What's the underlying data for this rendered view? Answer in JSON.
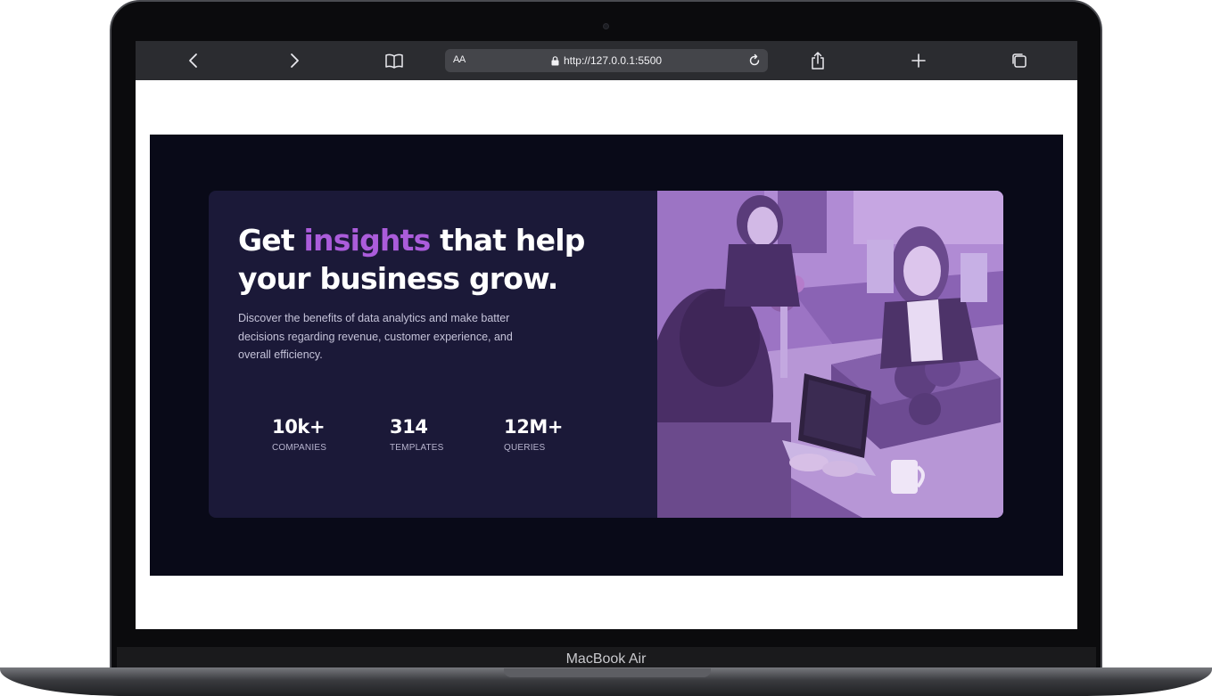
{
  "browser": {
    "text_size_label": "AA",
    "url": "http://127.0.0.1:5500",
    "icons": [
      "chevron-left-icon",
      "chevron-right-icon",
      "book-icon",
      "lock-icon",
      "reload-icon",
      "share-icon",
      "plus-icon",
      "tabs-icon"
    ]
  },
  "device": {
    "brand_label": "MacBook Air"
  },
  "hero": {
    "headline_before": "Get ",
    "headline_accent": "insights",
    "headline_after": " that help your business grow.",
    "description": "Discover the benefits of data analytics and make batter decisions regarding revenue, customer experience, and overall efficiency.",
    "stats": [
      {
        "value": "10k+",
        "label": "COMPANIES"
      },
      {
        "value": "314",
        "label": "TEMPLATES"
      },
      {
        "value": "12M+",
        "label": "QUERIES"
      }
    ]
  },
  "colors": {
    "page_background": "#090a18",
    "card_background": "#1b1938",
    "accent": "#ab5cdb",
    "photo_tint": "#9a6fc2"
  }
}
